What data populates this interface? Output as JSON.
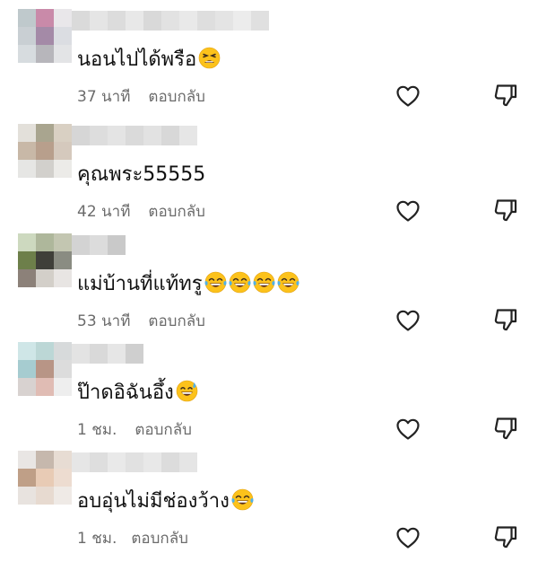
{
  "comments": [
    {
      "text": "นอนไปได้พรือ",
      "emojis": [
        "tired-face-emoji"
      ],
      "time": "37 นาที",
      "reply_label": "ตอบกลับ",
      "avatar_colors": [
        "#bfc9cc",
        "#c98aa9",
        "#e9e7ea",
        "#c9cfd3",
        "#a48aa7",
        "#dbdde2",
        "#d7dcdf",
        "#b7b6bb",
        "#e3e4e6"
      ],
      "username_colors": [
        "#dadada",
        "#e5e5e5",
        "#dcdcdc",
        "#e8e8e8",
        "#d9d9d9",
        "#e2e2e2",
        "#e9e9e9",
        "#dedede",
        "#e4e4e4",
        "#ececec",
        "#e0e0e0"
      ]
    },
    {
      "text": "คุณพระ55555",
      "emojis": [],
      "time": "42 นาที",
      "reply_label": "ตอบกลับ",
      "avatar_colors": [
        "#e3e0da",
        "#a9a58f",
        "#d9d0c3",
        "#c8b8a7",
        "#b89f8c",
        "#d5c9bd",
        "#e6e6e4",
        "#d2d0cc",
        "#ecebe8"
      ],
      "username_colors": [
        "#d6d6d6",
        "#dddddd",
        "#e4e4e4",
        "#dadada",
        "#e2e2e2",
        "#d8d8d8",
        "#e6e6e6"
      ]
    },
    {
      "text": "แม่บ้านที่แท้ทรู",
      "emojis": [
        "joy-emoji",
        "joy-emoji",
        "joy-emoji",
        "joy-emoji"
      ],
      "time": "53 นาที",
      "reply_label": "ตอบกลับ",
      "avatar_colors": [
        "#cdd9bf",
        "#aeb79b",
        "#c3c6b1",
        "#6d7f4a",
        "#3f3f39",
        "#8a8c82",
        "#8c8179",
        "#d3cfc9",
        "#e8e5e3"
      ],
      "username_colors": [
        "#d3d3d3",
        "#dcdcdc",
        "#c9c9c9"
      ]
    },
    {
      "text": "ป๊าดอิฉันอึ้ง",
      "emojis": [
        "sweat-smile-emoji"
      ],
      "time": "1 ชม.",
      "reply_label": "ตอบกลับ",
      "avatar_colors": [
        "#cfe6e7",
        "#bcd7d6",
        "#d7dadb",
        "#a6ccd0",
        "#b89586",
        "#dcdcdc",
        "#d8d2d0",
        "#e0bcb4",
        "#eeeeee"
      ],
      "username_colors": [
        "#e3e3e3",
        "#d9d9d9",
        "#e6e6e6",
        "#cfcfcf"
      ]
    },
    {
      "text": "อบอุ่นไม่มีช่องว้าง",
      "emojis": [
        "joy-emoji"
      ],
      "time": "1 ชม.",
      "reply_label": "ตอบกลับ",
      "avatar_colors": [
        "#e9e6e4",
        "#c6b8ad",
        "#e7dcd3",
        "#bf9f87",
        "#e8cbb5",
        "#eddcd0",
        "#e8e3df",
        "#e7dad0",
        "#efeae6"
      ],
      "username_colors": [
        "#e6e6e6",
        "#dedede",
        "#e9e9e9",
        "#e1e1e1",
        "#e8e8e8",
        "#dcdcdc",
        "#e5e5e5"
      ]
    }
  ]
}
